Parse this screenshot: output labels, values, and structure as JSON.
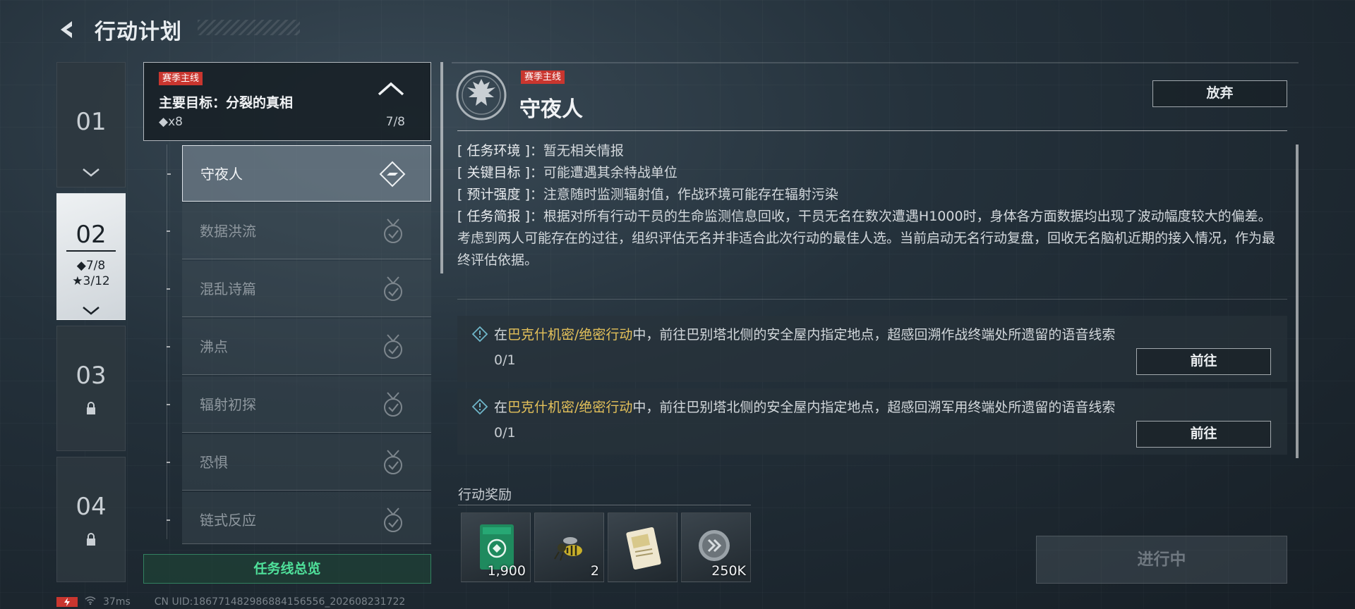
{
  "header": {
    "title": "行动计划"
  },
  "chapters": [
    {
      "num": "01"
    },
    {
      "num": "02",
      "diamond": "◆7/8",
      "star": "★3/12"
    },
    {
      "num": "03"
    },
    {
      "num": "04"
    }
  ],
  "main_goal": {
    "tag": "赛季主线",
    "title": "主要目标：分裂的真相",
    "reward": "◆x8",
    "count": "7/8"
  },
  "missions": [
    {
      "label": "守夜人",
      "status": "in-progress"
    },
    {
      "label": "数据洪流",
      "status": "completed"
    },
    {
      "label": "混乱诗篇",
      "status": "completed"
    },
    {
      "label": "沸点",
      "status": "completed"
    },
    {
      "label": "辐射初探",
      "status": "completed"
    },
    {
      "label": "恐惧",
      "status": "completed"
    },
    {
      "label": "链式反应",
      "status": "completed"
    }
  ],
  "overview_button": "任务线总览",
  "detail": {
    "tag": "赛季主线",
    "title": "守夜人",
    "abandon": "放弃",
    "info": [
      {
        "key": "[ 任务环境 ]",
        "sep": "：",
        "value": "暂无相关情报"
      },
      {
        "key": "[ 关键目标 ]",
        "sep": "：",
        "value": "可能遭遇其余特战单位"
      },
      {
        "key": "[ 预计强度 ]",
        "sep": "：",
        "value": "注意随时监测辐射值，作战环境可能存在辐射污染"
      },
      {
        "key": "[ 任务简报 ]",
        "sep": "：",
        "value": "根据对所有行动干员的生命监测信息回收，干员无名在数次遭遇H1000时，身体各方面数据均出现了波动幅度较大的偏差。考虑到两人可能存在的过往，组织评估无名并非适合此次行动的最佳人选。当前启动无名行动复盘，回收无名脑机近期的接入情况，作为最终评估依据。"
      }
    ],
    "objectives": [
      {
        "pre": "在",
        "highlight": "巴克什机密/绝密行动",
        "post": "中，前往巴别塔北侧的安全屋内指定地点，超感回溯作战终端处所遗留的语音线索",
        "progress": "0/1",
        "button": "前往"
      },
      {
        "pre": "在",
        "highlight": "巴克什机密/绝密行动",
        "post": "中，前往巴别塔北侧的安全屋内指定地点，超感回溯军用终端处所遗留的语音线索",
        "progress": "0/1",
        "button": "前往"
      }
    ]
  },
  "rewards": {
    "label": "行动奖励",
    "items": [
      {
        "icon": "green-card-icon",
        "count": "1,900"
      },
      {
        "icon": "wasp-icon",
        "count": "2"
      },
      {
        "icon": "document-icon",
        "count": ""
      },
      {
        "icon": "coin-icon",
        "count": "250K"
      }
    ]
  },
  "status_button": "进行中",
  "statusbar": {
    "ping": "37ms",
    "uid": "CN UID:186771482986884156556_202608231722"
  },
  "colors": {
    "accent_red": "#c9362f",
    "highlight_gold": "#e4c15a",
    "overview_green": "#4fe09a"
  }
}
